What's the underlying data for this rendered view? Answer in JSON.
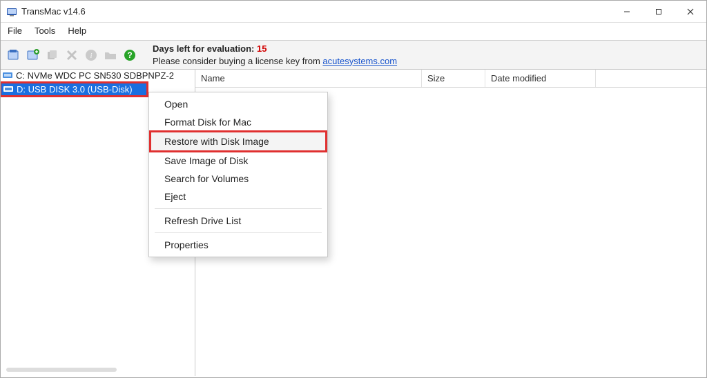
{
  "title": "TransMac v14.6",
  "menubar": {
    "file": "File",
    "tools": "Tools",
    "help": "Help"
  },
  "toolbar": {
    "msg_bold": "Days left for evaluation:",
    "msg_days": "15",
    "msg_sub": "Please consider buying a license key from ",
    "msg_link": "acutesystems.com"
  },
  "sidebar": {
    "drives": [
      {
        "label": "C:  NVMe WDC PC SN530 SDBPNPZ-2"
      },
      {
        "label": "D:  USB DISK 3.0 (USB-Disk)"
      }
    ]
  },
  "columns": {
    "name": "Name",
    "size": "Size",
    "date": "Date modified"
  },
  "context_menu": {
    "open": "Open",
    "format": "Format Disk for Mac",
    "restore": "Restore with Disk Image",
    "save_image": "Save Image of Disk",
    "search": "Search for Volumes",
    "eject": "Eject",
    "refresh": "Refresh Drive List",
    "properties": "Properties"
  }
}
